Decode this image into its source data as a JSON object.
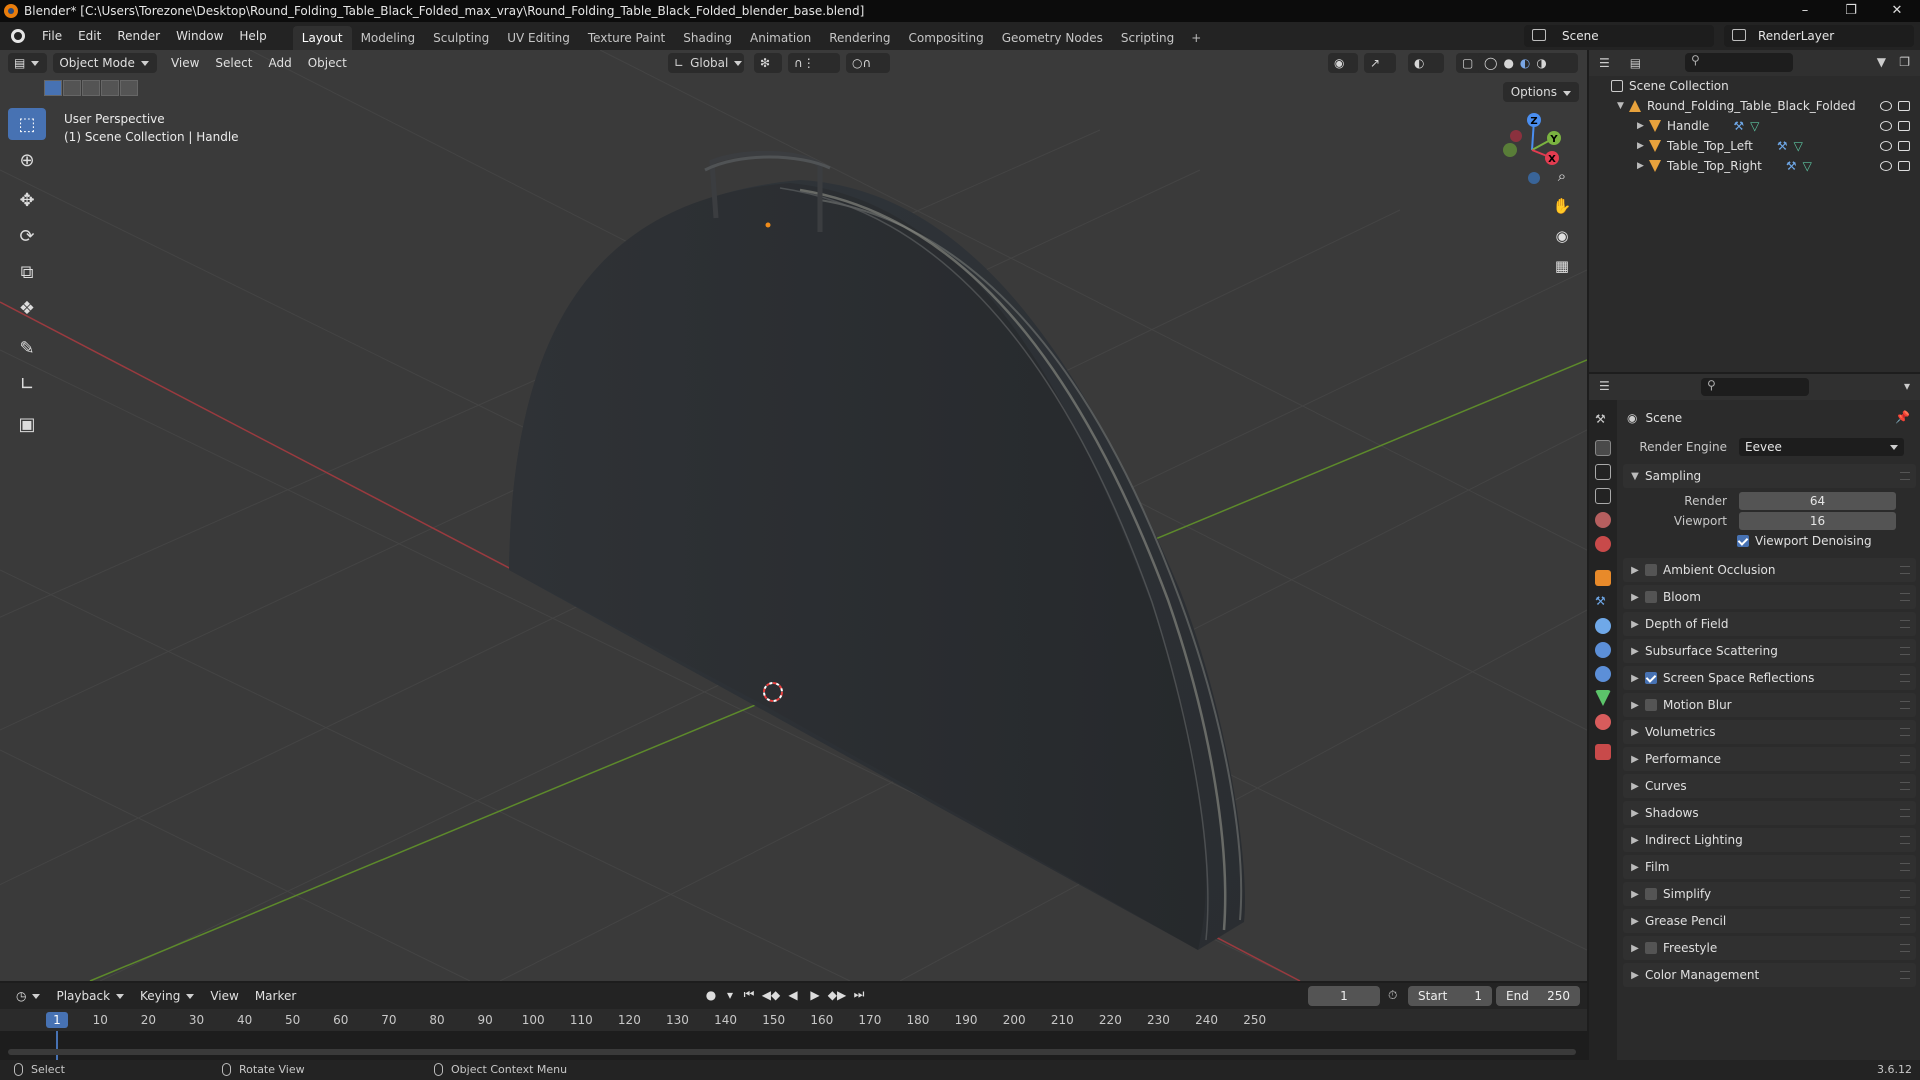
{
  "window": {
    "title": "Blender* [C:\\Users\\Torezone\\Desktop\\Round_Folding_Table_Black_Folded_max_vray\\Round_Folding_Table_Black_Folded_blender_base.blend]",
    "controls": [
      "minimize-icon",
      "restore-icon",
      "close-icon"
    ]
  },
  "menus": [
    "File",
    "Edit",
    "Render",
    "Window",
    "Help"
  ],
  "workspaces": [
    {
      "label": "Layout",
      "active": true
    },
    {
      "label": "Modeling"
    },
    {
      "label": "Sculpting"
    },
    {
      "label": "UV Editing"
    },
    {
      "label": "Texture Paint"
    },
    {
      "label": "Shading"
    },
    {
      "label": "Animation"
    },
    {
      "label": "Rendering"
    },
    {
      "label": "Compositing"
    },
    {
      "label": "Geometry Nodes"
    },
    {
      "label": "Scripting"
    }
  ],
  "workspace_add": "+",
  "scene_name": "Scene",
  "render_layer": "RenderLayer",
  "viewport": {
    "mode": "Object Mode",
    "menus": [
      "View",
      "Select",
      "Add",
      "Object"
    ],
    "transform_orientation": "Global",
    "options_label": "Options",
    "info_line1": "User Perspective",
    "info_line2": "(1) Scene Collection | Handle",
    "gizmo_axes": {
      "x": "X",
      "y": "Y",
      "z": "Z"
    },
    "colors": {
      "background": "#3a3a3a",
      "grid": "#444444",
      "x_axis": "#9a3a3f",
      "y_axis": "#5d8a2b",
      "object": "#2c2f33"
    }
  },
  "toolbar": [
    "select-box-icon",
    "cursor-icon",
    "move-icon",
    "rotate-icon",
    "scale-icon",
    "transform-icon",
    "annotate-icon",
    "measure-icon",
    "add-cube-icon"
  ],
  "outliner": {
    "root": "Scene Collection",
    "collection": "Round_Folding_Table_Black_Folded",
    "objects": [
      "Handle",
      "Table_Top_Left",
      "Table_Top_Right"
    ]
  },
  "properties": {
    "context": "Scene",
    "render_engine_label": "Render Engine",
    "render_engine": "Eevee",
    "sampling_title": "Sampling",
    "render_label": "Render",
    "render_samples": "64",
    "viewport_label": "Viewport",
    "viewport_samples": "16",
    "viewport_denoising_label": "Viewport Denoising",
    "viewport_denoising": true,
    "panels": [
      {
        "label": "Ambient Occlusion",
        "checkbox": true,
        "checked": false
      },
      {
        "label": "Bloom",
        "checkbox": true,
        "checked": false
      },
      {
        "label": "Depth of Field"
      },
      {
        "label": "Subsurface Scattering"
      },
      {
        "label": "Screen Space Reflections",
        "checkbox": true,
        "checked": true
      },
      {
        "label": "Motion Blur",
        "checkbox": true,
        "checked": false
      },
      {
        "label": "Volumetrics"
      },
      {
        "label": "Performance"
      },
      {
        "label": "Curves"
      },
      {
        "label": "Shadows"
      },
      {
        "label": "Indirect Lighting"
      },
      {
        "label": "Film"
      },
      {
        "label": "Simplify",
        "checkbox": true,
        "checked": false
      },
      {
        "label": "Grease Pencil"
      },
      {
        "label": "Freestyle",
        "checkbox": true,
        "checked": false
      },
      {
        "label": "Color Management"
      }
    ]
  },
  "timeline": {
    "menus": [
      "Playback",
      "Keying",
      "View",
      "Marker"
    ],
    "current_frame": "1",
    "start_label": "Start",
    "start": "1",
    "end_label": "End",
    "end": "250",
    "ruler_labels": [
      "10",
      "20",
      "30",
      "40",
      "50",
      "60",
      "70",
      "80",
      "90",
      "100",
      "110",
      "120",
      "130",
      "140",
      "150",
      "160",
      "170",
      "180",
      "190",
      "200",
      "210",
      "220",
      "230",
      "240",
      "250"
    ],
    "playhead": "1"
  },
  "statusbar": {
    "select": "Select",
    "rotate_view": "Rotate View",
    "context_menu": "Object Context Menu",
    "version": "3.6.12"
  }
}
